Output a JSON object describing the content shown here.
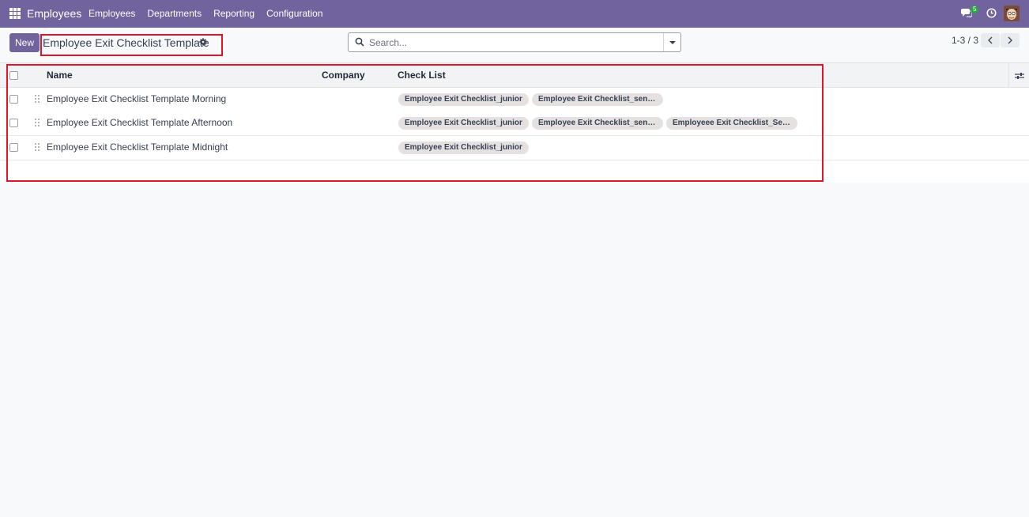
{
  "navbar": {
    "brand": "Employees",
    "menu": [
      "Employees",
      "Departments",
      "Reporting",
      "Configuration"
    ],
    "chat_badge": "5"
  },
  "control_panel": {
    "new_label": "New",
    "breadcrumb_title": "Employee Exit Checklist Template",
    "search_placeholder": "Search...",
    "pager_value": "1-3 / 3"
  },
  "list": {
    "columns": [
      "Name",
      "Company",
      "Check List"
    ],
    "rows": [
      {
        "name": "Employee Exit Checklist Template Morning",
        "company": "",
        "checklist": [
          "Employee Exit Checklist_junior",
          "Employee Exit Checklist_senior"
        ]
      },
      {
        "name": "Employee Exit Checklist Template Afternoon",
        "company": "",
        "checklist": [
          "Employee Exit Checklist_junior",
          "Employee Exit Checklist_senior",
          "Employeee Exit Checklist_Seni..."
        ]
      },
      {
        "name": "Employee Exit Checklist Template Midnight",
        "company": "",
        "checklist": [
          "Employee Exit Checklist_junior"
        ]
      }
    ]
  },
  "colors": {
    "navbar": "#71639e",
    "highlight": "#e0142b",
    "tag_bg": "#e6e1e1"
  }
}
